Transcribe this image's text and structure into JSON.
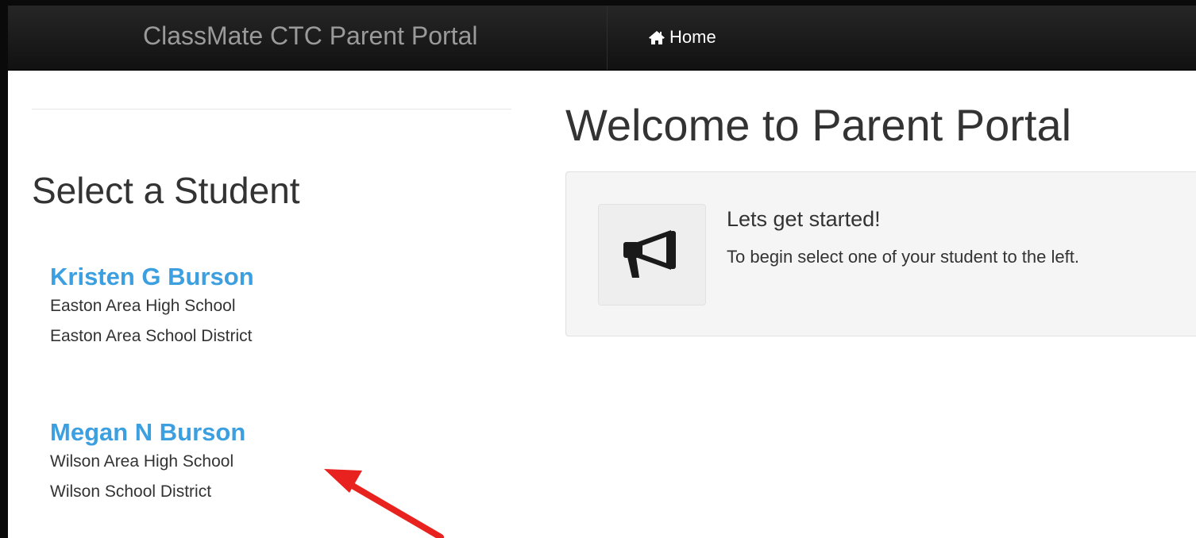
{
  "navbar": {
    "brand": "ClassMate CTC Parent Portal",
    "home_label": "Home",
    "home_icon": "home-icon"
  },
  "sidebar": {
    "title": "Select a Student",
    "students": [
      {
        "name": "Kristen G Burson",
        "school": "Easton Area High School",
        "district": "Easton Area School District"
      },
      {
        "name": "Megan N Burson",
        "school": "Wilson Area High School",
        "district": "Wilson School District"
      }
    ]
  },
  "main": {
    "title": "Welcome to Parent Portal",
    "panel": {
      "icon": "megaphone-icon",
      "heading": "Lets get started!",
      "text": "To begin select one of your student to the left."
    }
  },
  "annotation": {
    "color": "#e8231f",
    "icon": "red-arrow-annotation"
  },
  "colors": {
    "link": "#3c9fe0",
    "navbar": "#1a1a1a"
  }
}
